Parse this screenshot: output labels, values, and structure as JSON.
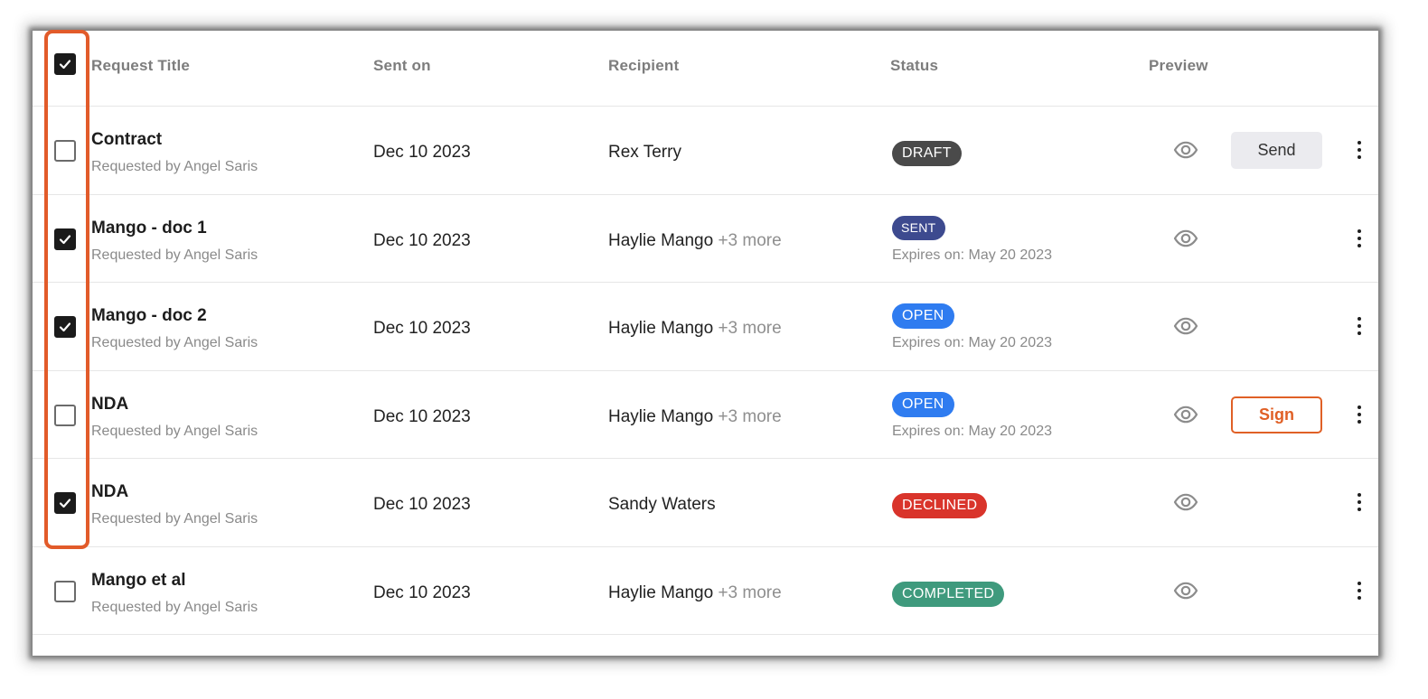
{
  "headers": {
    "request_title": "Request Title",
    "sent_on": "Sent on",
    "recipient": "Recipient",
    "status": "Status",
    "preview": "Preview"
  },
  "select_all_checked": true,
  "rows": [
    {
      "title": "Contract",
      "requested_by": "Requested by Angel Saris",
      "sent_on": "Dec 10 2023",
      "recipient": "Rex Terry",
      "more": "",
      "status": "DRAFT",
      "status_color": "#4a4a4a",
      "expires": "",
      "checked": false,
      "action": "Send"
    },
    {
      "title": "Mango - doc 1",
      "requested_by": "Requested by Angel Saris",
      "sent_on": "Dec 10 2023",
      "recipient": "Haylie Mango",
      "more": "+3 more",
      "status": "SENT",
      "status_color": "#3d4a8f",
      "expires": "Expires on: May 20 2023",
      "checked": true,
      "action": ""
    },
    {
      "title": "Mango - doc 2",
      "requested_by": "Requested by Angel Saris",
      "sent_on": "Dec 10 2023",
      "recipient": "Haylie Mango",
      "more": "+3 more",
      "status": "OPEN",
      "status_color": "#2f7cf0",
      "expires": "Expires on: May 20 2023",
      "checked": true,
      "action": ""
    },
    {
      "title": "NDA",
      "requested_by": "Requested by Angel Saris",
      "sent_on": "Dec 10 2023",
      "recipient": "Haylie Mango",
      "more": "+3 more",
      "status": "OPEN",
      "status_color": "#2f7cf0",
      "expires": "Expires on: May 20 2023",
      "checked": false,
      "action": "Sign"
    },
    {
      "title": "NDA",
      "requested_by": "Requested by Angel Saris",
      "sent_on": "Dec 10 2023",
      "recipient": "Sandy Waters",
      "more": "",
      "status": "DECLINED",
      "status_color": "#d9342b",
      "expires": "",
      "checked": true,
      "action": ""
    },
    {
      "title": "Mango et al",
      "requested_by": "Requested by Angel Saris",
      "sent_on": "Dec 10 2023",
      "recipient": "Haylie Mango",
      "more": "+3 more",
      "status": "COMPLETED",
      "status_color": "#3f9a7d",
      "expires": "",
      "checked": false,
      "action": ""
    }
  ],
  "icons": {
    "preview": "eye-icon",
    "menu": "kebab-menu-icon",
    "check": "checkmark-icon"
  },
  "accent_highlight": "#e25b2a"
}
